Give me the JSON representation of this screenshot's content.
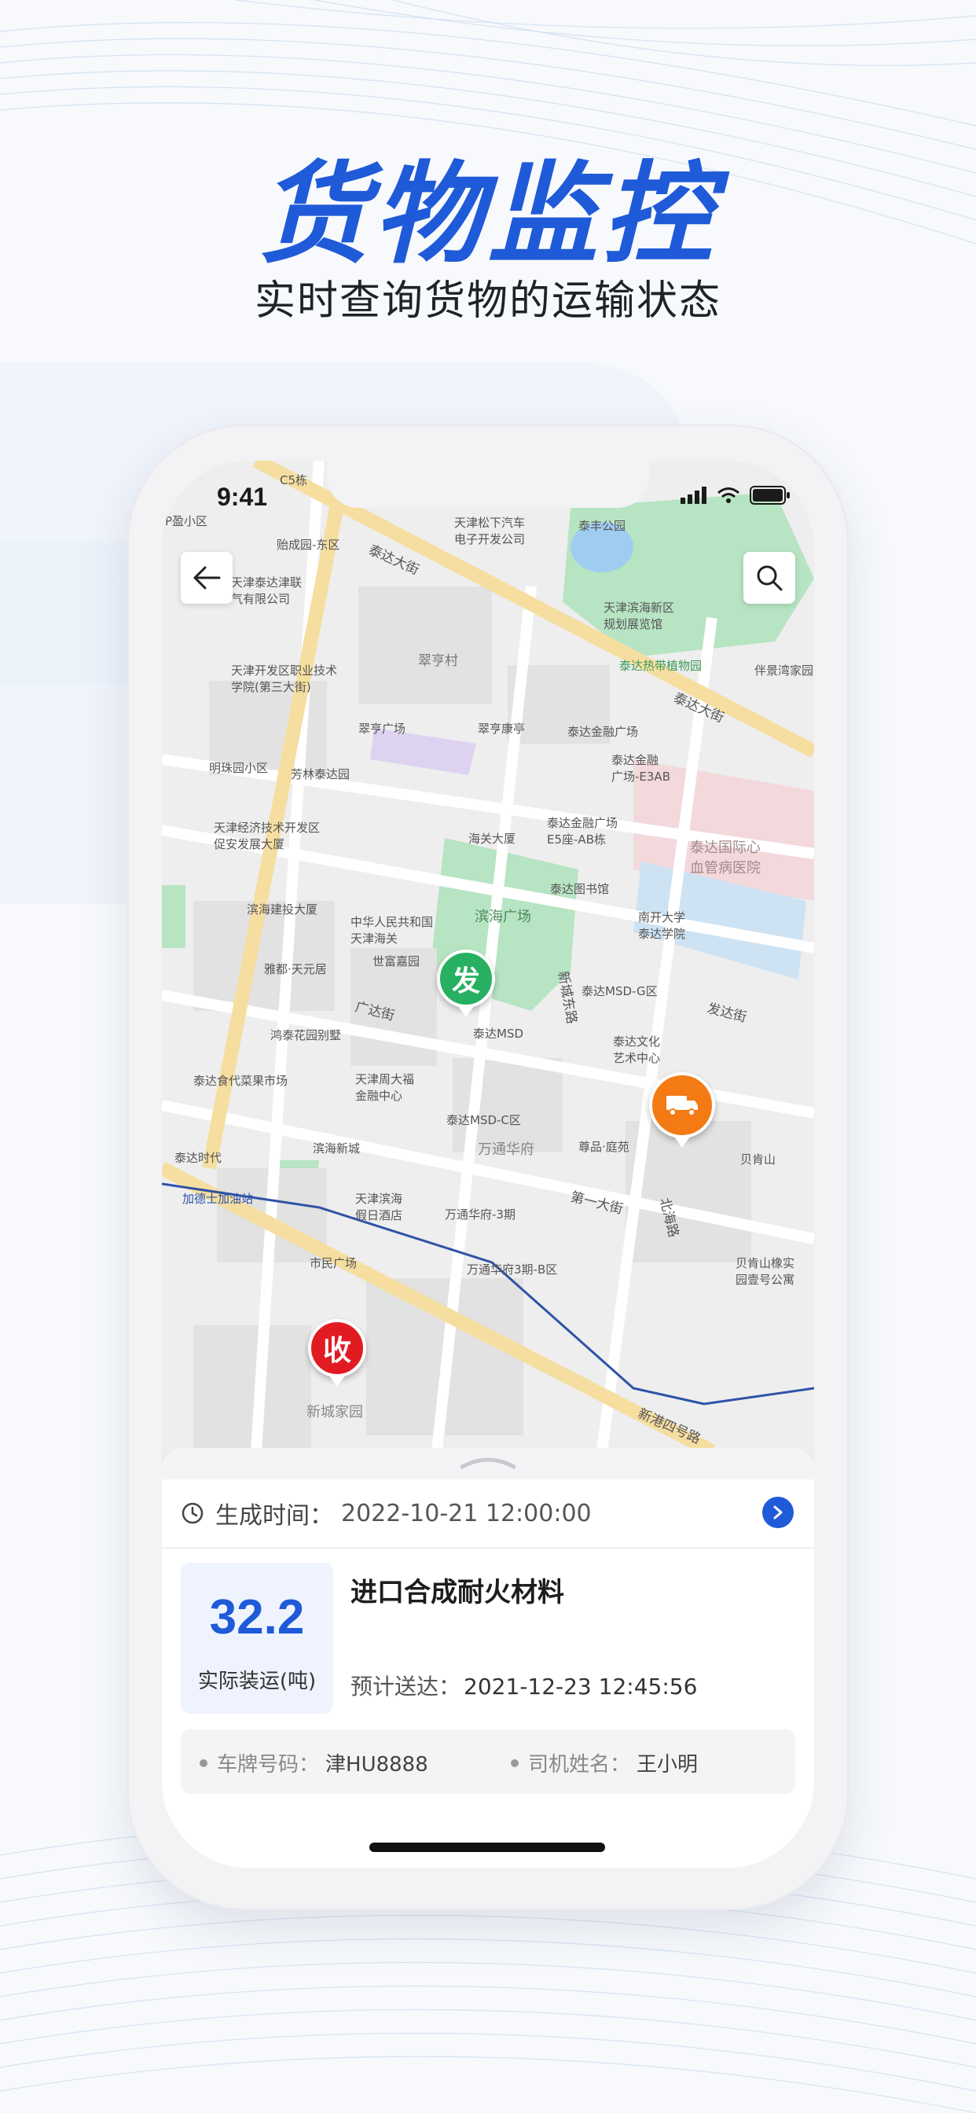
{
  "hero": {
    "title": "货物监控",
    "subtitle": "实时查询货物的运输状态"
  },
  "status_bar": {
    "time": "9:41"
  },
  "map": {
    "labels": {
      "c5": "C5栋",
      "pangyao": "P盈小区",
      "yiyuan": "贻成园-东区",
      "songxia": "天津松下汽车\n电子开发公司",
      "taifeng": "泰丰公园",
      "taidajinlian": "天津泰达津联\n气有限公司",
      "taidaxinqu": "天津滨海新区\n规划展览馆",
      "zhiye": "天津开发区职业技术\n学院(第三大街)",
      "cuiheng": "翠亨村",
      "redai": "泰达热带植物园",
      "banjing": "伴景湾家园",
      "cuihengguangchang": "翠亨广场",
      "cuihengkangting": "翠亨康亭",
      "jinrongguangchang": "泰达金融广场",
      "jinrongE3": "泰达金融\n广场-E3AB",
      "mingzhu": "明珠园小区",
      "fanglin": "芳林泰达园",
      "jingji": "天津经济技术开发区\n促安发展大厦",
      "haiguan": "海关大厦",
      "E5": "泰达金融广场\nE5座-AB栋",
      "xueguan": "泰达国际心\n血管病医院",
      "tushuguan": "泰达图书馆",
      "nankai": "南开大学\n泰达学院",
      "binhaijianshe": "滨海建投大厦",
      "haiguan2": "中华人民共和国\n天津海关",
      "binhaiguangchang": "滨海广场",
      "yadu": "雅都·天元居",
      "shifu": "世富嘉园",
      "MSDG": "泰达MSD-G区",
      "wenhua": "泰达文化\n艺术中心",
      "hongtai": "鸿泰花园别墅",
      "MSD": "泰达MSD",
      "shidai": "泰达食代菜果市场",
      "zhoudafu": "天津周大福\n金融中心",
      "MSDC": "泰达MSD-C区",
      "zunpin": "尊品·庭苑",
      "beikenshan": "贝肯山",
      "taidashidai": "泰达时代",
      "binhaixincheng": "滨海新城",
      "wantong": "万通华府",
      "jiari": "天津滨海\n假日酒店",
      "wantong3": "万通华府-3期",
      "jiadeshi": "加德士加油站",
      "shimin": "市民广场",
      "wantongB": "万通华府3期-B区",
      "beikenshanxiang": "贝肯山橡实\n园壹号公寓",
      "xincheng": "新城家园"
    },
    "roads": {
      "taida1": "泰达大街",
      "taida2": "泰达大街",
      "guangda": "广达街",
      "xinchengdong": "新城东路",
      "fada": "发达街",
      "diyi": "第一大街",
      "beihai": "北海路",
      "xingang": "新港四号路"
    },
    "pins": {
      "origin": "发",
      "destination": "收"
    }
  },
  "sheet": {
    "time_label": "生成时间：",
    "time_value": "2022-10-21 12:00:00",
    "weight_value": "32.2",
    "weight_label": "实际装运(吨)",
    "cargo_name": "进口合成耐火材料",
    "eta_label": "预计送达：",
    "eta_value": "2021-12-23   12:45:56",
    "plate_label": "车牌号码：",
    "plate_value": "津HU8888",
    "driver_label": "司机姓名：",
    "driver_value": "王小明"
  },
  "colors": {
    "brand_blue": "#1f5ad8",
    "origin_green": "#27b061",
    "destination_red": "#e21b23",
    "truck_orange": "#f47a14"
  },
  "icons": [
    "back-arrow-icon",
    "search-icon",
    "signal-icon",
    "wifi-icon",
    "battery-icon",
    "truck-icon",
    "clock-icon",
    "chevron-right-icon"
  ]
}
